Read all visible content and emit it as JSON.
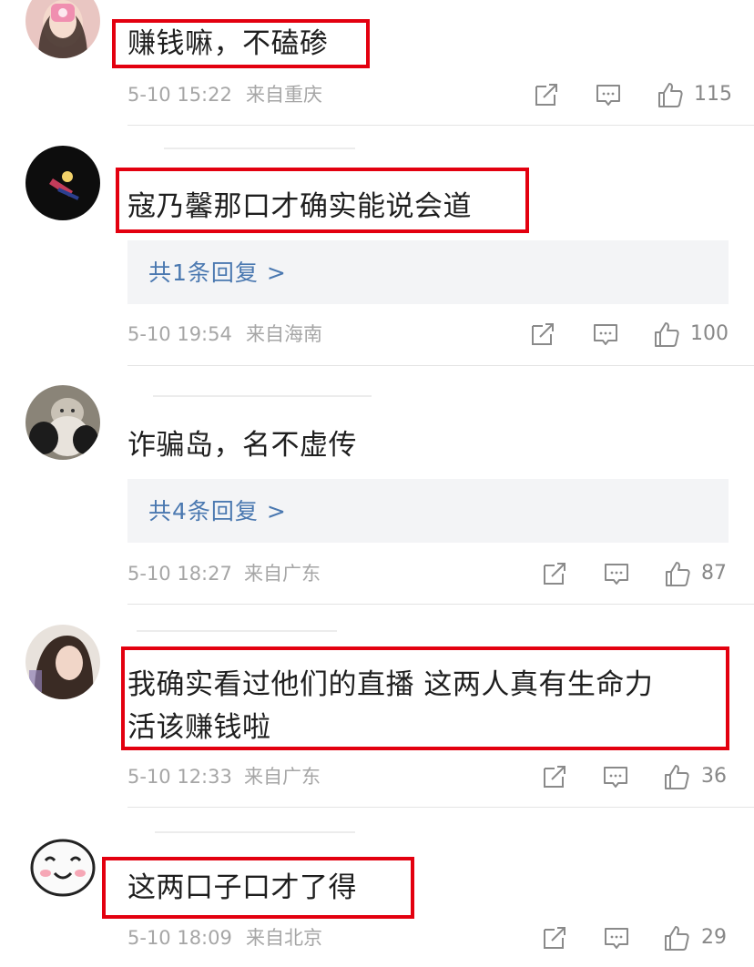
{
  "comments": [
    {
      "text": "赚钱嘛，不磕碜",
      "time": "5-10 15:22",
      "loc": "来自重庆",
      "likes": "115",
      "avatar": "girl-avatar"
    },
    {
      "text": "寇乃馨那口才确实能说会道",
      "replies": "共1条回复 >",
      "time": "5-10 19:54",
      "loc": "来自海南",
      "likes": "100",
      "avatar": "sailor-moon-avatar"
    },
    {
      "text": "诈骗岛，名不虚传",
      "replies": "共4条回复 >",
      "time": "5-10 18:27",
      "loc": "来自广东",
      "likes": "87",
      "avatar": "cat-avatar"
    },
    {
      "text_line1": "我确实看过他们的直播 这两人真有生命力",
      "text_line2": "活该赚钱啦",
      "time": "5-10 12:33",
      "loc": "来自广东",
      "likes": "36",
      "avatar": "woman-avatar"
    },
    {
      "text": "这两口子口才了得",
      "time": "5-10 18:09",
      "loc": "来自北京",
      "likes": "29",
      "avatar": "cartoon-face-avatar"
    }
  ],
  "colors": {
    "highlight": "#e3000f",
    "reply_link": "#4a78b0",
    "meta_gray": "#a6a6a6"
  },
  "icons": [
    "share-icon",
    "comment-icon",
    "like-icon"
  ]
}
